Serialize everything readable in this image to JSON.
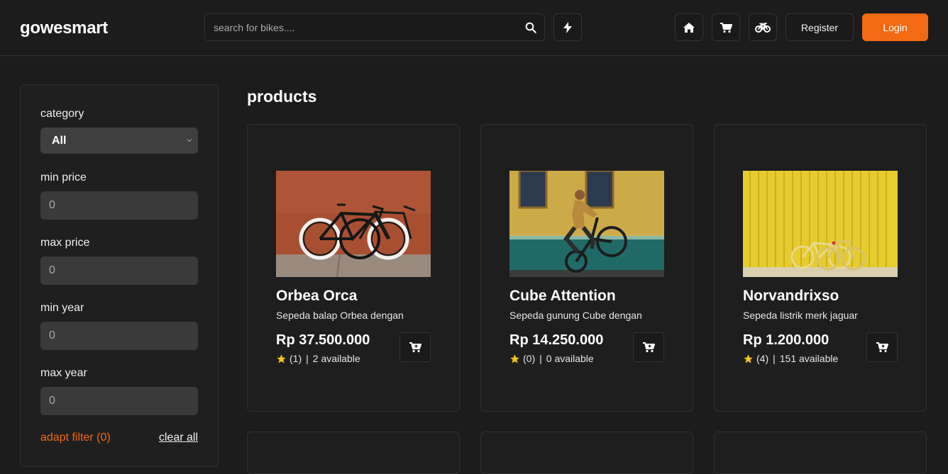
{
  "brand": "gowesmart",
  "search": {
    "placeholder": "search for bikes...."
  },
  "nav": {
    "register_label": "Register",
    "login_label": "Login",
    "icons": [
      "bolt-icon",
      "home-icon",
      "cart-icon",
      "bike-icon"
    ]
  },
  "colors": {
    "accent": "#f36a12",
    "background": "#1c1c1c",
    "star": "#f5c518"
  },
  "filters": {
    "category_label": "category",
    "category_value": "All",
    "min_price_label": "min price",
    "min_price_value": "0",
    "max_price_label": "max price",
    "max_price_value": "0",
    "min_year_label": "min year",
    "min_year_value": "0",
    "max_year_label": "max year",
    "max_year_value": "0",
    "adapt_label": "adapt filter (0)",
    "clear_label": "clear all"
  },
  "products_title": "products",
  "products": [
    {
      "name": "Orbea Orca",
      "description": "Sepeda balap Orbea dengan",
      "price": "Rp 37.500.000",
      "rating_count": "(1)",
      "availability": "2 available"
    },
    {
      "name": "Cube Attention",
      "description": "Sepeda gunung Cube dengan",
      "price": "Rp 14.250.000",
      "rating_count": "(0)",
      "availability": "0 available"
    },
    {
      "name": "Norvandrixso",
      "description": "Sepeda listrik merk jaguar",
      "price": "Rp 1.200.000",
      "rating_count": "(4)",
      "availability": "151 available"
    }
  ]
}
